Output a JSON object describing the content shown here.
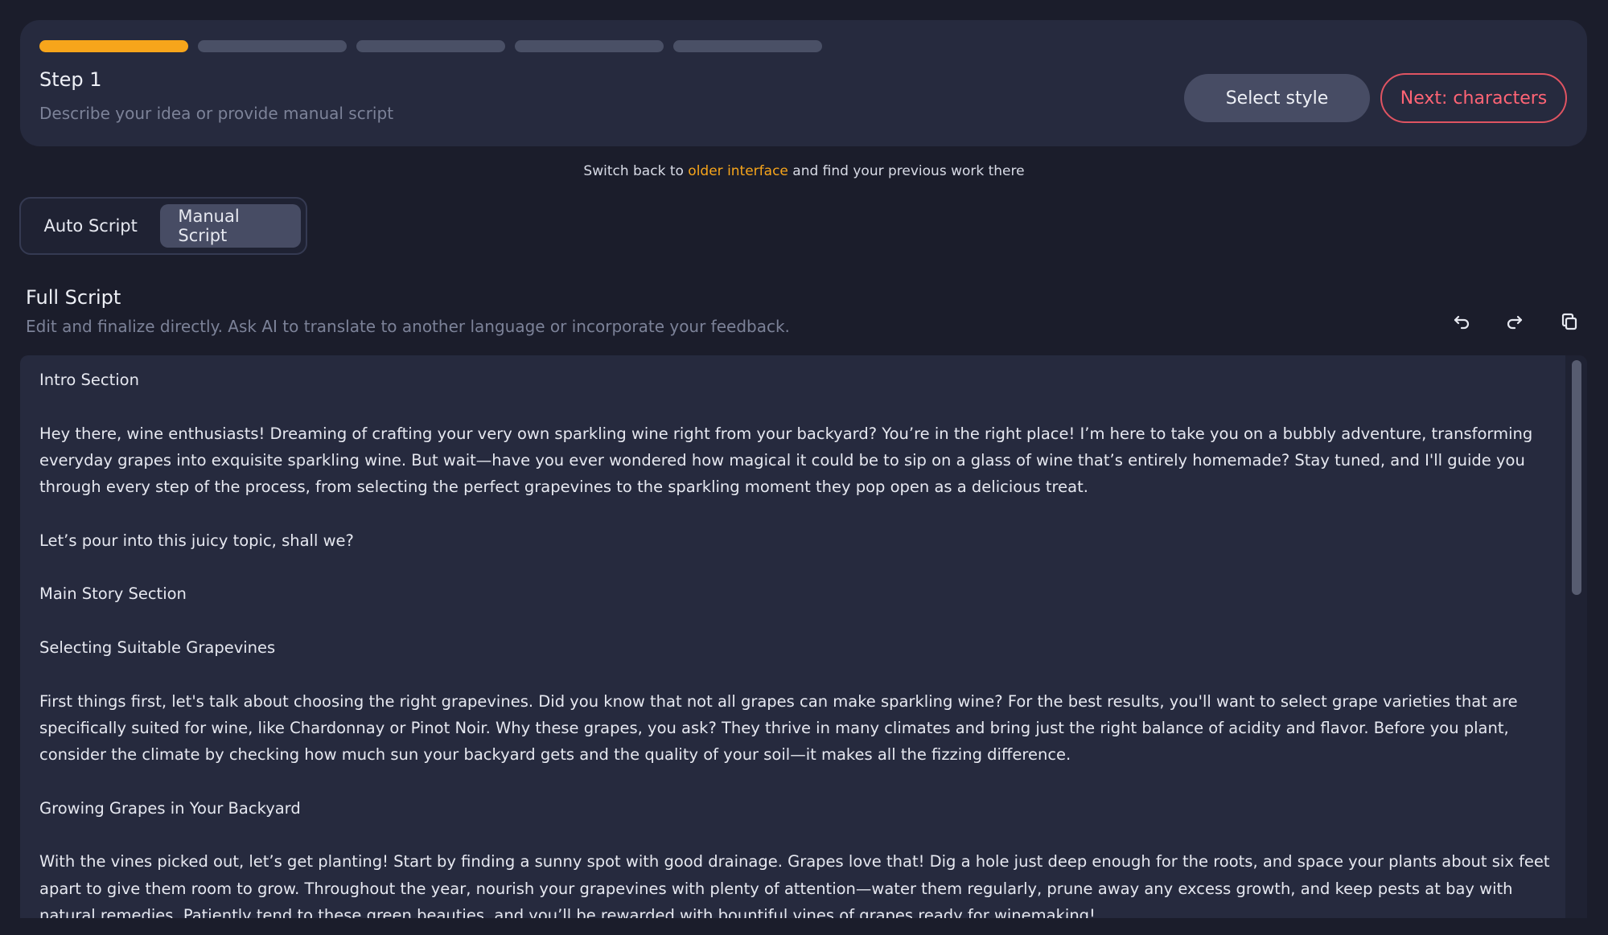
{
  "step": {
    "progress_total": 5,
    "progress_current": 1,
    "title": "Step 1",
    "subtitle": "Describe your idea or provide manual script",
    "select_style_label": "Select style",
    "next_label": "Next: characters"
  },
  "notice": {
    "prefix": "Switch back to",
    "link": "older interface",
    "suffix": "and find your previous work there"
  },
  "mode_tabs": {
    "auto": "Auto Script",
    "manual": "Manual Script",
    "selected": "Manual Script"
  },
  "script": {
    "title": "Full Script",
    "subtitle": "Edit and finalize directly. Ask AI to translate to another language or incorporate your feedback.",
    "icons": [
      "undo-icon",
      "redo-icon",
      "copy-icon"
    ],
    "paragraphs": [
      "Intro Section",
      "Hey there, wine enthusiasts! Dreaming of crafting your very own sparkling wine right from your backyard? You’re in the right place! I’m here to take you on a bubbly adventure, transforming everyday grapes into exquisite sparkling wine. But wait—have you ever wondered how magical it could be to sip on a glass of wine that’s entirely homemade? Stay tuned, and I'll guide you through every step of the process, from selecting the perfect grapevines to the sparkling moment they pop open as a delicious treat.",
      "Let’s pour into this juicy topic, shall we?",
      "Main Story Section",
      "Selecting Suitable Grapevines",
      "First things first, let's talk about choosing the right grapevines. Did you know that not all grapes can make sparkling wine? For the best results, you'll want to select grape varieties that are specifically suited for wine, like Chardonnay or Pinot Noir. Why these grapes, you ask? They thrive in many climates and bring just the right balance of acidity and flavor. Before you plant, consider the climate by checking how much sun your backyard gets and the quality of your soil—it makes all the fizzing difference.",
      "Growing Grapes in Your Backyard",
      "With the vines picked out, let’s get planting! Start by finding a sunny spot with good drainage. Grapes love that! Dig a hole just deep enough for the roots, and space your plants about six feet apart to give them room to grow. Throughout the year, nourish your grapevines with plenty of attention—water them regularly, prune away any excess growth, and keep pests at bay with natural remedies. Patiently tend to these green beauties, and you’ll be rewarded with bountiful vines of grapes ready for winemaking!"
    ]
  },
  "colors": {
    "background": "#1b1d2b",
    "card": "#262a3e",
    "accent": "#f7a51b",
    "danger": "#ff6475"
  }
}
